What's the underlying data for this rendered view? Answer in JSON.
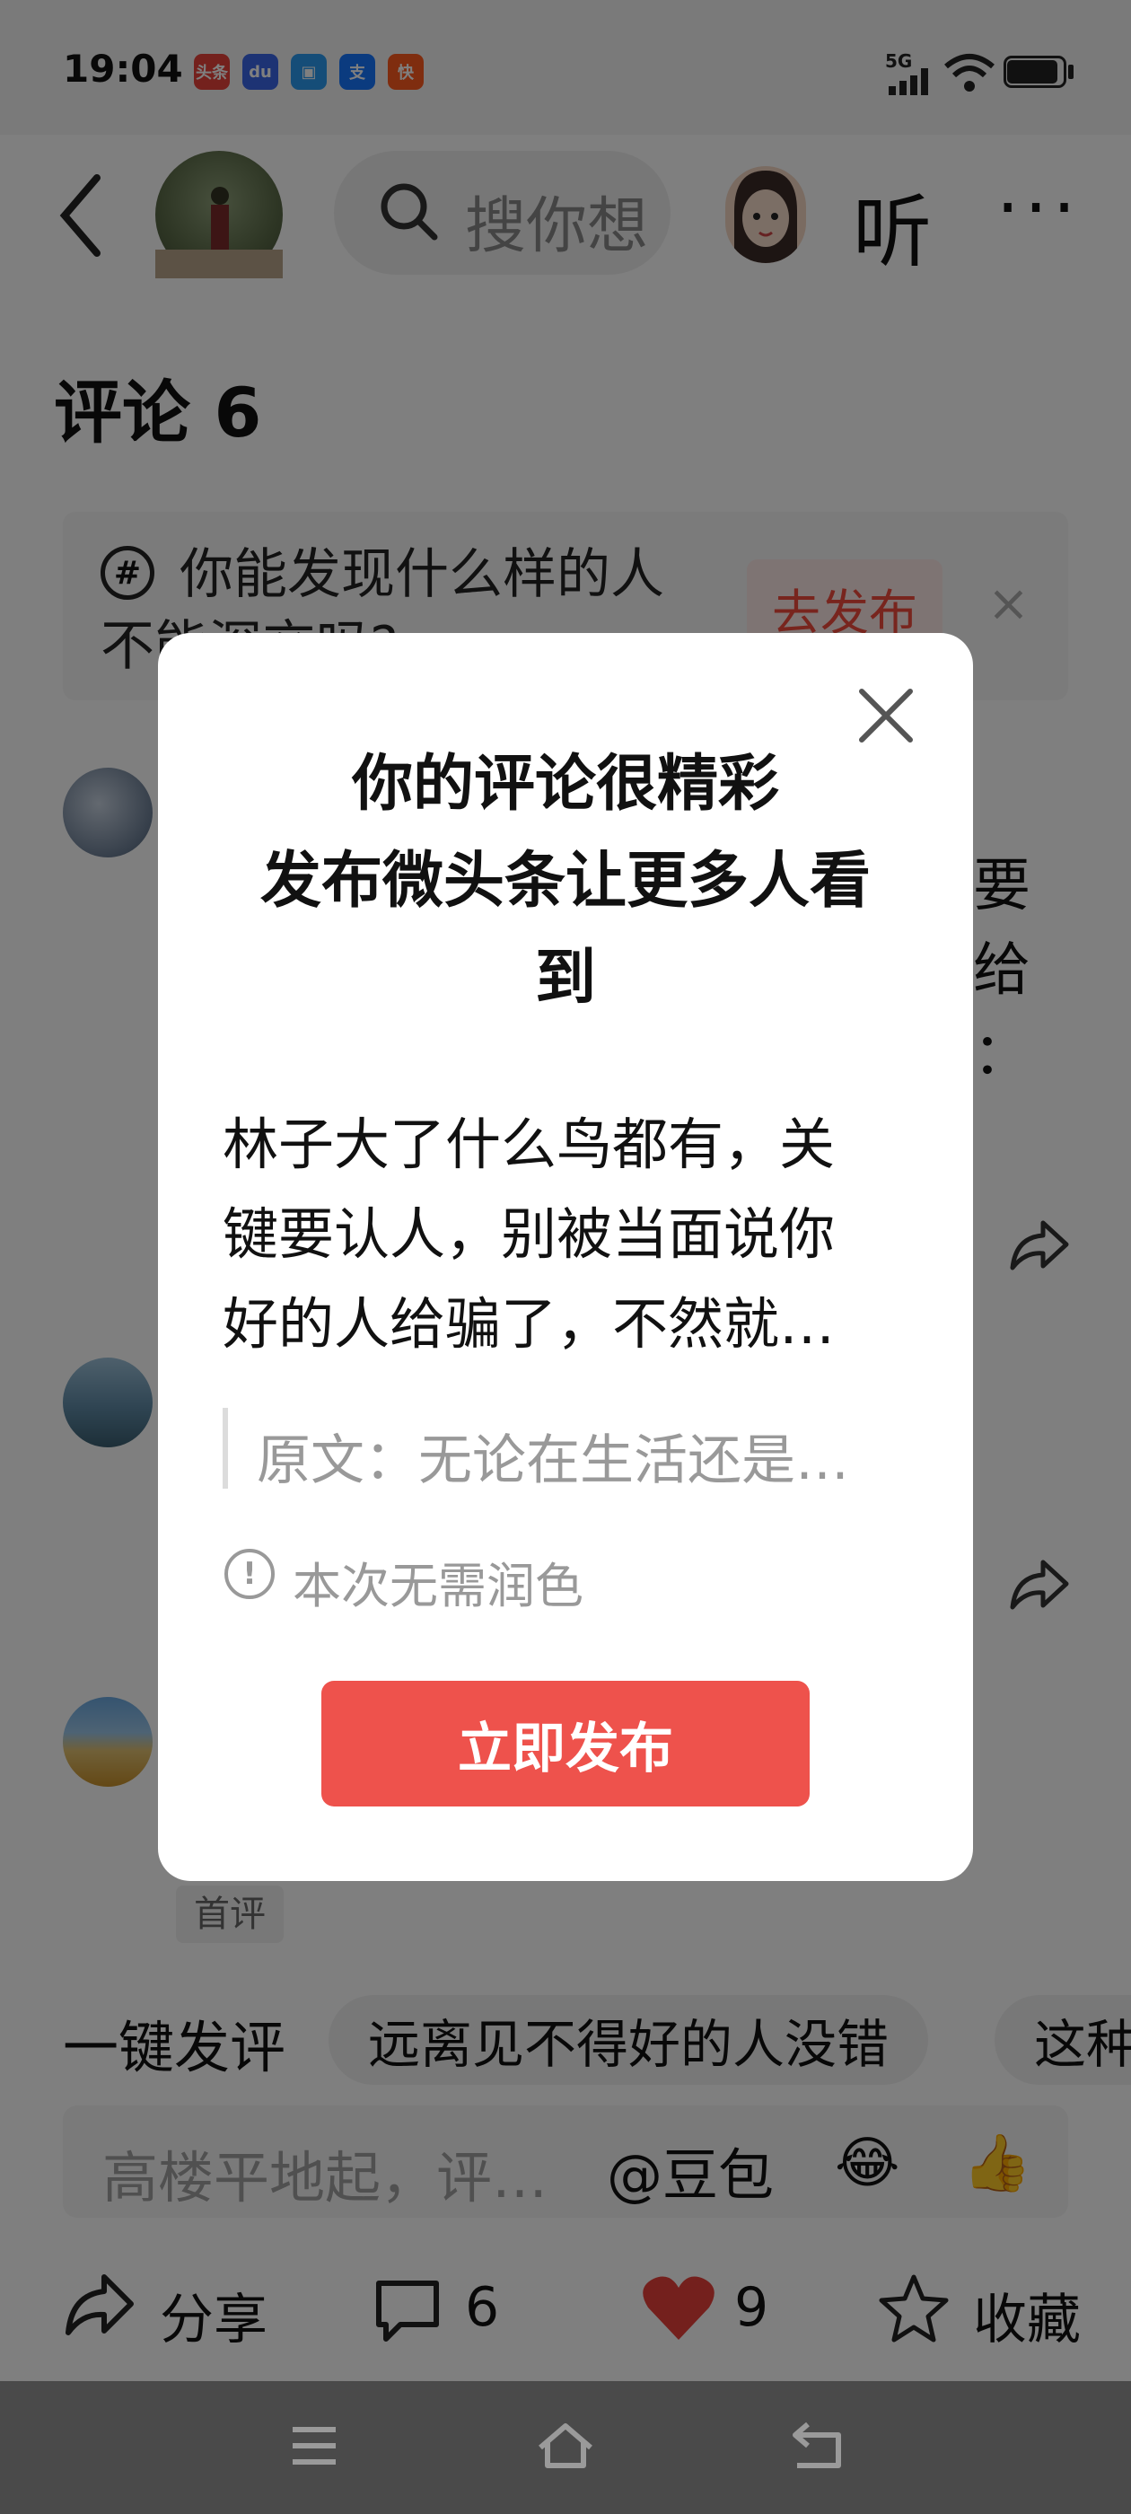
{
  "status_bar": {
    "time": "19:04",
    "network": "5G",
    "notif_icons": [
      {
        "name": "toutiao-icon",
        "label": "头条",
        "color": "#e8433a"
      },
      {
        "name": "baidu-icon",
        "label": "du",
        "color": "#3a66e8"
      },
      {
        "name": "app-icon",
        "label": "▣",
        "color": "#2a9af0"
      },
      {
        "name": "alipay-icon",
        "label": "支",
        "color": "#1677ff"
      },
      {
        "name": "kuaishou-icon",
        "label": "快",
        "color": "#ff5a1f"
      }
    ]
  },
  "header": {
    "search_placeholder": "搜你想",
    "listen_label": "听",
    "more_label": "···"
  },
  "comments": {
    "title": "评论 6",
    "topic": {
      "text": "你能发现什么样的人不能深交吗?",
      "publish_label": "去发布",
      "close_label": "×"
    },
    "fragments": {
      "line1": "要",
      "line2": "给",
      "line3": "："
    },
    "first_tag": "首评"
  },
  "chips": {
    "label": "一键发评",
    "items": [
      "远离见不得好的人没错",
      "这种"
    ]
  },
  "input": {
    "placeholder": "高楼平地起，评…",
    "mention": "@豆包",
    "emoji_laugh": "😂",
    "emoji_thumb": "👍"
  },
  "actions": {
    "share_label": "分享",
    "comment_count": "6",
    "like_count": "9",
    "favorite_label": "收藏"
  },
  "dialog": {
    "title_lines": [
      "你的评论很精彩",
      "发布微头条让更多人看",
      "到"
    ],
    "body": "林子大了什么鸟都有，关键要认人，别被当面说你好的人给骗了，不然就…",
    "quote": "原文：无论在生活还是…",
    "info": "本次无需润色",
    "publish_button": "立即发布"
  },
  "colors": {
    "accent_red": "#ee524c",
    "like_red": "#e8403a"
  }
}
